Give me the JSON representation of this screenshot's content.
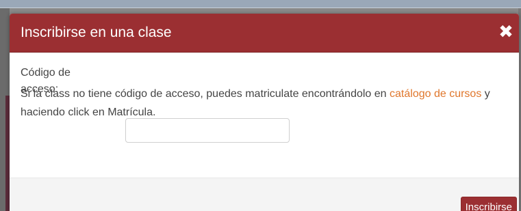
{
  "modal": {
    "title": "Inscribirse en una clase",
    "close_icon": "close-icon",
    "close_glyph": "✖"
  },
  "form": {
    "access_code_label": "Código de acceso:",
    "access_code_value": "",
    "access_code_placeholder": ""
  },
  "help": {
    "text_before": "Si la class no tiene código de acceso, puedes matriculate encontrándolo en ",
    "catalog_link": "catálogo de cursos",
    "text_after": " y haciendo click en Matrícula."
  },
  "footer": {
    "enroll_label": "Inscribirse"
  },
  "colors": {
    "header": "#9b2f32",
    "link": "#e0762b",
    "button": "#9b2f32"
  }
}
